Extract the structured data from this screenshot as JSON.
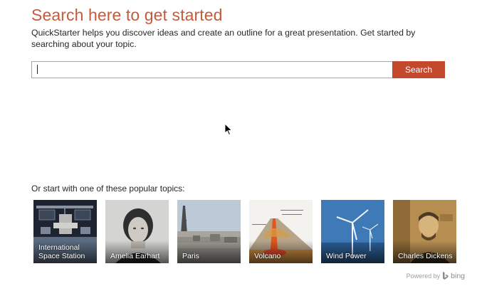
{
  "header": {
    "title": "Search here to get started",
    "subtitle": "QuickStarter helps you discover ideas and create an outline for a great presentation. Get started by searching about your topic."
  },
  "search": {
    "value": "",
    "placeholder": "",
    "button_label": "Search"
  },
  "popular": {
    "label": "Or start with one of these popular topics:",
    "topics": [
      {
        "label": "International Space Station"
      },
      {
        "label": "Amelia Earhart"
      },
      {
        "label": "Paris"
      },
      {
        "label": "Volcano"
      },
      {
        "label": "Wind Power"
      },
      {
        "label": "Charles Dickens"
      }
    ]
  },
  "footer": {
    "powered_by": "Powered by",
    "brand": "bing"
  },
  "colors": {
    "accent": "#c65a3b",
    "button": "#c4482b"
  }
}
